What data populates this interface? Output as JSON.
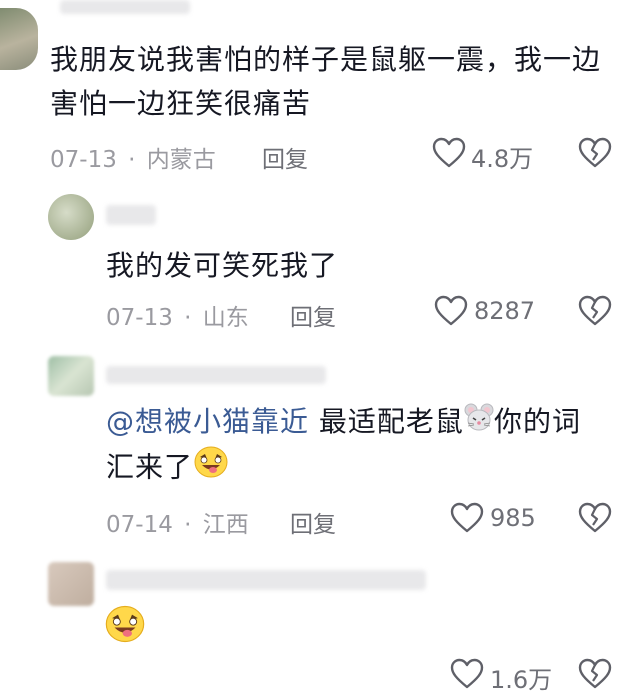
{
  "comments": [
    {
      "text": "我朋友说我害怕的样子是鼠躯一震，我一边害怕一边狂笑很痛苦",
      "date": "07-13",
      "location": "内蒙古",
      "reply_label": "回复",
      "likes": "4.8万"
    },
    {
      "text": "我的发可笑死我了",
      "date": "07-13",
      "location": "山东",
      "reply_label": "回复",
      "likes": "8287"
    },
    {
      "mention": "@想被小猫靠近",
      "text_a": "最适配老鼠",
      "text_b": "你的词",
      "text_c": "汇来了",
      "date": "07-14",
      "location": "江西",
      "reply_label": "回复",
      "likes": "985"
    },
    {
      "likes": "1.6万"
    }
  ],
  "separator": "·",
  "icons": {
    "like": "heart-outline-icon",
    "dislike": "broken-heart-icon",
    "emoji_mouse": "mouse-face-emoji",
    "emoji_laugh": "laughing-tongue-emoji"
  },
  "colors": {
    "text": "#161823",
    "meta": "#9a9aa0",
    "mention": "#3b5b94"
  }
}
